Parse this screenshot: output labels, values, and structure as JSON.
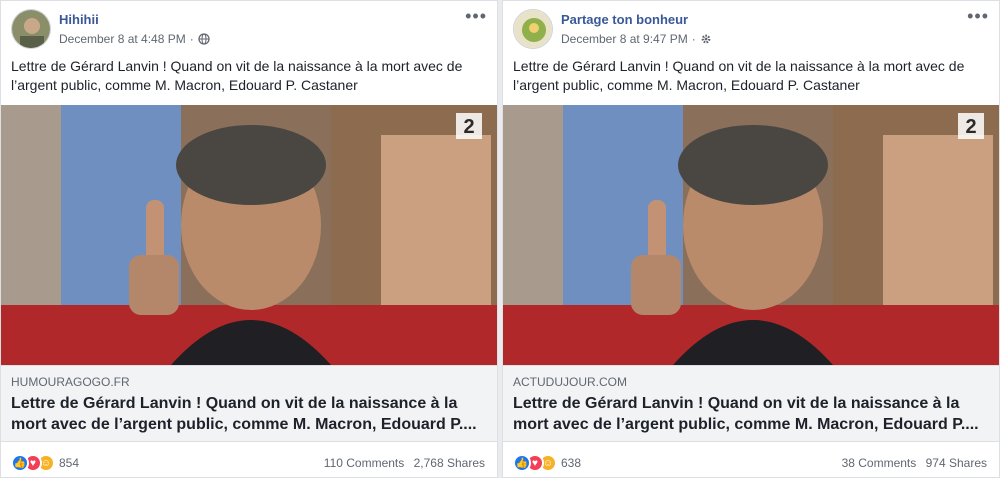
{
  "posts": [
    {
      "author": "Hihihii",
      "date": "December 8 at 4:48 PM",
      "privacy_icon": "globe-icon",
      "text": "Lettre de Gérard Lanvin ! Quand on vit de la naissance à la mort avec de l’argent public, comme M. Macron, Edouard P. Castaner",
      "link_domain": "HUMOURAGOGO.FR",
      "link_title": "Lettre de Gérard Lanvin ! Quand on vit de la naissance à la mort avec de l’argent public, comme M. Macron, Edouard P....",
      "reaction_count": "854",
      "comments": "110 Comments",
      "shares": "2,768 Shares"
    },
    {
      "author": "Partage ton bonheur",
      "date": "December 8 at 9:47 PM",
      "privacy_icon": "gear-icon",
      "text": "Lettre de Gérard Lanvin ! Quand on vit de la naissance à la mort avec de l’argent public, comme M. Macron, Edouard P. Castaner",
      "link_domain": "ACTUDUJOUR.COM",
      "link_title": "Lettre de Gérard Lanvin ! Quand on vit de la naissance à la mort avec de l’argent public, comme M. Macron, Edouard P....",
      "reaction_count": "638",
      "comments": "38 Comments",
      "shares": "974 Shares"
    }
  ],
  "image_badge": "2",
  "colors": {
    "author": "#385898",
    "like": "#1877f2",
    "love": "#f33e58",
    "haha": "#f7b125"
  }
}
